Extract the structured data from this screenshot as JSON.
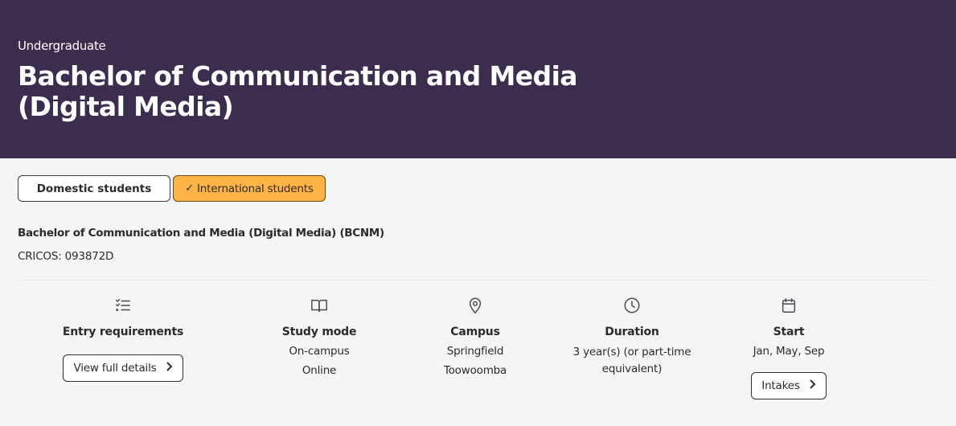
{
  "hero": {
    "level": "Undergraduate",
    "title": "Bachelor of Communication and Media (Digital Media)",
    "background_color": "#3c2c4e"
  },
  "tabs": [
    {
      "label": "Domestic students",
      "selected": false
    },
    {
      "label": "International students",
      "selected": true,
      "icon": "check-icon",
      "accent_color": "#ffb445"
    }
  ],
  "program": {
    "name": "Bachelor of Communication and Media (Digital Media) (BCNM)",
    "cricos": "CRICOS: 093872D"
  },
  "details": {
    "entry": {
      "icon": "checklist-icon",
      "heading": "Entry requirements",
      "button": "View full details"
    },
    "study_mode": {
      "icon": "book-icon",
      "heading": "Study mode",
      "values": [
        "On-campus",
        "Online"
      ]
    },
    "campus": {
      "icon": "map-pin-icon",
      "heading": "Campus",
      "values": [
        "Springfield",
        "Toowoomba"
      ]
    },
    "duration": {
      "icon": "clock-icon",
      "heading": "Duration",
      "value_line1": "3 year(s) (or part-time",
      "value_line2": "equivalent)"
    },
    "start": {
      "icon": "calendar-icon",
      "heading": "Start",
      "value": "Jan, May, Sep",
      "button": "Intakes"
    }
  }
}
